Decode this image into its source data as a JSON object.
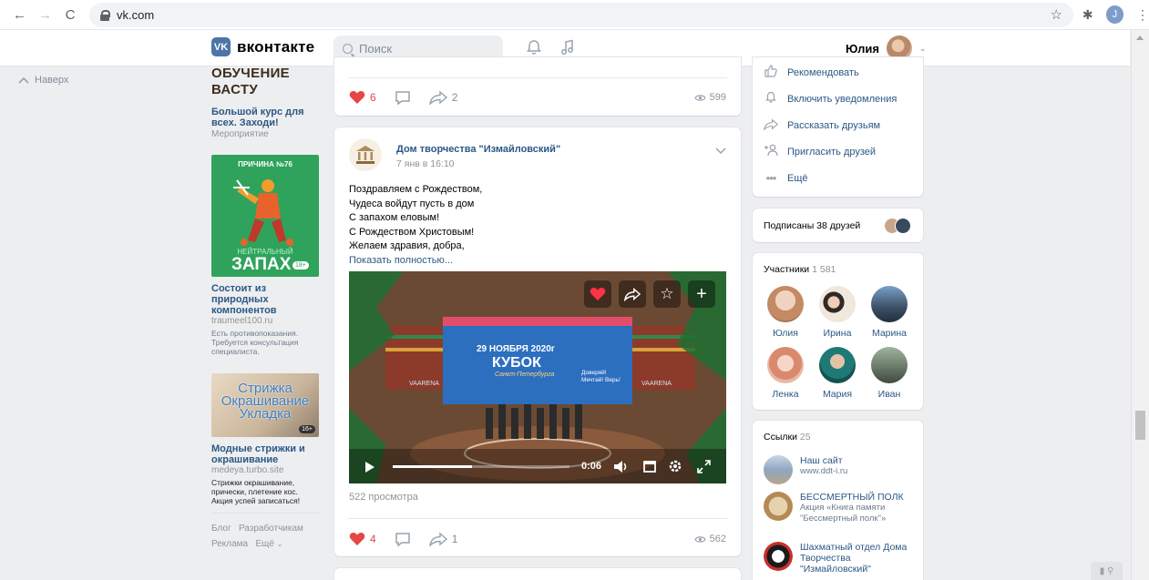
{
  "browser": {
    "url": "vk.com",
    "profile_initial": "J"
  },
  "header": {
    "logo_text": "вконтакте",
    "search_placeholder": "Поиск",
    "user_name": "Юлия"
  },
  "left_nav": {
    "up_label": "Наверх"
  },
  "ads": [
    {
      "banner_text": "ОБУЧЕНИЕ ВАСТУ",
      "title": "Большой курс для всех. Заходи!",
      "subtitle": "Мероприятие"
    },
    {
      "banner_top": "ПРИЧИНА №76",
      "banner_mid": "НЕЙТРАЛЬНЫЙ",
      "banner_big": "ЗАПАХ",
      "banner_age": "18+",
      "title": "Состоит из природных компонентов",
      "subtitle": "traumeel100.ru",
      "desc": "Есть противопоказания. Требуется консультация специалиста."
    },
    {
      "banner_lines": [
        "Стрижка",
        "Окрашивание",
        "Укладка"
      ],
      "banner_age": "16+",
      "title": "Модные стрижки и окрашивание",
      "subtitle": "medeya.turbo.site",
      "desc": "Стрижки окрашивание, прически, плетение кос. Акция успей записаться!"
    }
  ],
  "footer_links": {
    "blog": "Блог",
    "devs": "Разработчикам",
    "ads": "Реклама",
    "more": "Ещё"
  },
  "post1": {
    "likes": "6",
    "shares": "2",
    "views": "599"
  },
  "post2": {
    "author": "Дом творчества \"Измайловский\"",
    "date": "7 янв в 16:10",
    "text_lines": [
      "Поздравляем с Рождеством,",
      "Чудеса войдут пусть в дом",
      "С запахом еловым!",
      "С Рождеством Христовым!",
      "Желаем здравия, добра,"
    ],
    "show_more": "Показать полностью...",
    "video": {
      "time": "0:06",
      "banner_date": "29 НОЯБРЯ 2020г",
      "banner_title": "КУБОК",
      "banner_arena": "VAARENA",
      "banner_slogan": "Доверяй! Мечтай! Верь!",
      "banner_city": "Санкт-Петербурга",
      "progress": 0.45
    },
    "video_views": "522 просмотра",
    "likes": "4",
    "shares": "1",
    "views": "562"
  },
  "right_menu": [
    {
      "icon": "thumb-up-icon",
      "label": "Рекомендовать"
    },
    {
      "icon": "bell-icon",
      "label": "Включить уведомления"
    },
    {
      "icon": "share-icon",
      "label": "Рассказать друзьям"
    },
    {
      "icon": "add-user-icon",
      "label": "Пригласить друзей"
    },
    {
      "icon": "dots-icon",
      "label": "Ещё"
    }
  ],
  "friends_subscribed": "Подписаны 38 друзей",
  "members": {
    "title": "Участники",
    "count": "1 581",
    "people": [
      "Юлия",
      "Ирина",
      "Марина",
      "Ленка",
      "Мария",
      "Иван"
    ]
  },
  "links": {
    "title": "Ссылки",
    "count": "25",
    "items": [
      {
        "title": "Наш сайт",
        "sub": "www.ddt-i.ru"
      },
      {
        "title": "БЕССМЕРТНЫЙ ПОЛК",
        "sub": "Акция «Книга памяти \"Бессмертный полк\"»"
      },
      {
        "title": "Шахматный отдел Дома Творчества \"Измайловский\"",
        "sub": ""
      }
    ]
  },
  "colors": {
    "vk_blue": "#4a76a8",
    "link": "#2a5885",
    "like_red": "#e64646",
    "bg": "#edeef0"
  }
}
